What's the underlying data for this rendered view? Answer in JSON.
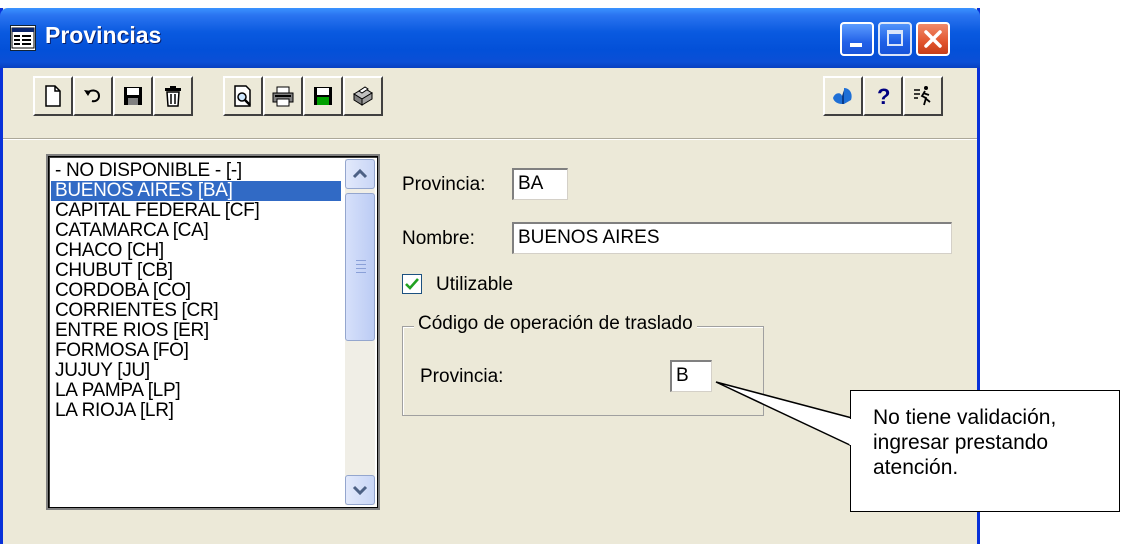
{
  "window": {
    "title": "Provincias",
    "icon": "form-window-icon"
  },
  "toolbar": {
    "left_buttons": [
      "new-document-icon",
      "undo-icon",
      "save-disk-icon",
      "trash-icon",
      "print-preview-icon",
      "printer-icon",
      "save-green-disk-icon",
      "fax-printer-icon"
    ],
    "right_buttons": [
      "wizard-icon",
      "help-question-icon",
      "exit-runner-icon"
    ]
  },
  "list": {
    "items": [
      "- NO DISPONIBLE -  [-]",
      "BUENOS AIRES  [BA]",
      "CAPITAL FEDERAL  [CF]",
      "CATAMARCA  [CA]",
      "CHACO  [CH]",
      "CHUBUT  [CB]",
      "CORDOBA  [CO]",
      "CORRIENTES  [CR]",
      "ENTRE RIOS  [ER]",
      "FORMOSA  [FO]",
      "JUJUY  [JU]",
      "LA PAMPA  [LP]",
      "LA RIOJA  [LR]"
    ],
    "selected_index": 1
  },
  "form": {
    "provincia_label": "Provincia:",
    "provincia_value": "BA",
    "nombre_label": "Nombre:",
    "nombre_value": "BUENOS AIRES",
    "utilizable_label": "Utilizable",
    "utilizable_checked": true,
    "group_title": "Código de operación de traslado",
    "group_provincia_label": "Provincia:",
    "group_provincia_value": "B"
  },
  "callout": {
    "text": "No tiene validación, ingresar prestando atención."
  },
  "colors": {
    "selection": "#316AC5",
    "titlebar": "#0350D8",
    "face": "#ECE9D8"
  }
}
